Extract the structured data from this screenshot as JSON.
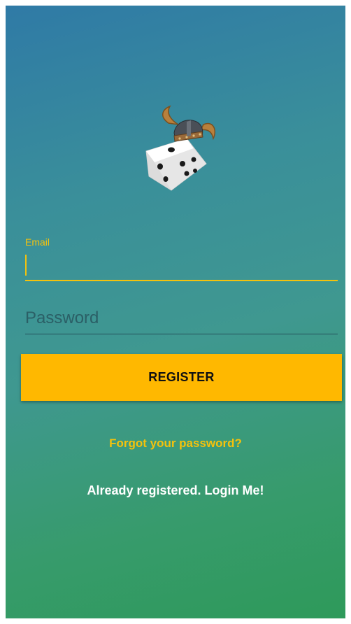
{
  "logo": {
    "icon": "viking-dice-icon"
  },
  "form": {
    "email_label": "Email",
    "email_value": "",
    "password_placeholder": "Password",
    "register_label": "REGISTER"
  },
  "links": {
    "forgot_password": "Forgot your password?",
    "login": "Already registered. Login Me!"
  },
  "colors": {
    "accent": "#f4c20d",
    "button": "#ffb800",
    "gradient_top": "#2f7aa6",
    "gradient_bottom": "#2e9a5a"
  }
}
